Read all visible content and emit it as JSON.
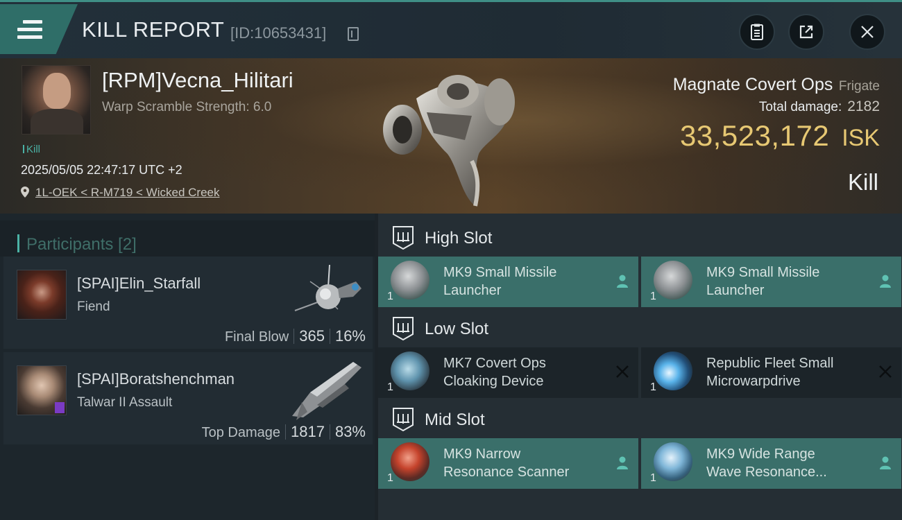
{
  "header": {
    "title": "KILL REPORT",
    "report_id": "[ID:10653431]"
  },
  "victim": {
    "name": "[RPM]Vecna_Hilitari",
    "scramble": "Warp Scramble Strength: 6.0",
    "tag": "Kill",
    "datetime": "2025/05/05 22:47:17 UTC +2",
    "location": "1L-OEK < R-M719 < Wicked Creek",
    "ship_name": "Magnate Covert Ops",
    "ship_class": "Frigate",
    "total_damage_label": "Total damage:",
    "total_damage": "2182",
    "isk_value": "33,523,172",
    "isk_unit": "ISK",
    "result": "Kill"
  },
  "participants": {
    "title": "Participants [2]",
    "items": [
      {
        "name": "[SPAI]Elin_Starfall",
        "ship": "Fiend",
        "role": "Final Blow",
        "damage": "365",
        "percent": "16%"
      },
      {
        "name": "[SPAI]Boratshenchman",
        "ship": "Talwar II Assault",
        "role": "Top Damage",
        "damage": "1817",
        "percent": "83%"
      }
    ]
  },
  "slots": [
    {
      "title": "High Slot",
      "modules": [
        {
          "qty": "1",
          "name_line1": "MK9 Small Missile",
          "name_line2": "Launcher",
          "state": "fitted"
        },
        {
          "qty": "1",
          "name_line1": "MK9 Small Missile",
          "name_line2": "Launcher",
          "state": "fitted"
        }
      ]
    },
    {
      "title": "Low Slot",
      "modules": [
        {
          "qty": "1",
          "name_line1": "MK7 Covert Ops",
          "name_line2": "Cloaking Device",
          "state": "destroyed"
        },
        {
          "qty": "1",
          "name_line1": "Republic Fleet Small",
          "name_line2": "Microwarpdrive",
          "state": "destroyed"
        }
      ]
    },
    {
      "title": "Mid Slot",
      "modules": [
        {
          "qty": "1",
          "name_line1": "MK9 Narrow",
          "name_line2": "Resonance Scanner",
          "state": "fitted"
        },
        {
          "qty": "1",
          "name_line1": "MK9 Wide Range",
          "name_line2": "Wave Resonance...",
          "state": "fitted"
        }
      ]
    }
  ],
  "colors": {
    "accent": "#3a6f6a",
    "isk": "#e7c873",
    "tag": "#4bb3a6"
  }
}
